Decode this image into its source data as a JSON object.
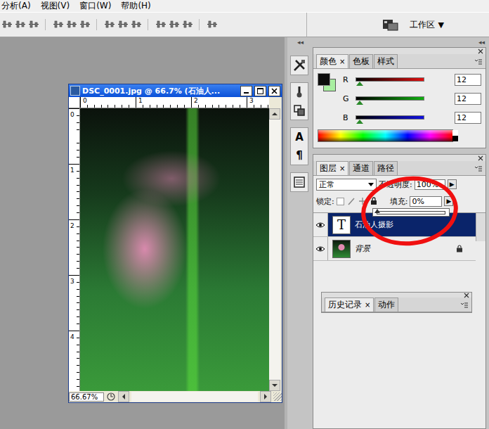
{
  "menu": [
    "分析(A)",
    "视图(V)",
    "窗口(W)",
    "帮助(H)"
  ],
  "options_bar": {
    "workspace": "工作区",
    "workspace_arrow": "▼"
  },
  "palette_well": {
    "collapse_left": "◂◂",
    "collapse_right": "◂◂",
    "tool_glyphs": [
      "A",
      "¶"
    ]
  },
  "document": {
    "title": "DSC_0001.jpg @ 66.7% (石油人...",
    "ruler_h": [
      "0",
      "1",
      "2",
      "3"
    ],
    "ruler_v": [
      "0",
      "1",
      "2",
      "3",
      "4"
    ],
    "zoom": "66.67%"
  },
  "color_panel": {
    "tabs": [
      {
        "label": "颜色",
        "selected": true
      },
      {
        "label": "色板",
        "selected": false
      },
      {
        "label": "样式",
        "selected": false
      }
    ],
    "close": "×",
    "channels": [
      {
        "name": "R",
        "value": "12",
        "level": 0.05,
        "color": "#e01010"
      },
      {
        "name": "G",
        "value": "12",
        "level": 0.05,
        "color": "#10b010"
      },
      {
        "name": "B",
        "value": "12",
        "level": 0.05,
        "color": "#1010e0"
      }
    ]
  },
  "layers_panel": {
    "tabs": [
      {
        "label": "图层",
        "selected": true
      },
      {
        "label": "通道",
        "selected": false
      },
      {
        "label": "路径",
        "selected": false
      }
    ],
    "close": "×",
    "blend_mode": "正常",
    "opacity_label": "不透明度:",
    "opacity": "100%",
    "lock_label": "锁定:",
    "fill_label": "填充:",
    "fill": "0%",
    "arrow": "▶",
    "fill_slider": {
      "level": 0
    },
    "layers": [
      {
        "name": "石油人摄影",
        "kind": "text",
        "thumb": "T",
        "visible": true,
        "selected": true,
        "locked": false
      },
      {
        "name": "背景",
        "kind": "image",
        "thumb": "",
        "visible": true,
        "selected": false,
        "locked": true
      }
    ]
  },
  "history_panel": {
    "tabs": [
      {
        "label": "历史记录",
        "selected": true
      },
      {
        "label": "动作",
        "selected": false
      }
    ],
    "close": "×"
  }
}
